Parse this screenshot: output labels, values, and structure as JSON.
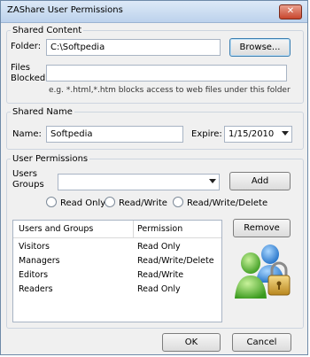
{
  "window": {
    "title": "ZAShare User Permissions",
    "close_glyph": "✕"
  },
  "shared_content": {
    "legend": "Shared Content",
    "folder_label": "Folder:",
    "folder_value": "C:\\Softpedia",
    "browse_label": "Browse...",
    "files_blocked_label_line1": "Files",
    "files_blocked_label_line2": "Blocked:",
    "files_blocked_value": "",
    "hint": "e.g. *.html,*.htm blocks access to web files under this folder"
  },
  "shared_name": {
    "legend": "Shared Name",
    "name_label": "Name:",
    "name_value": "Softpedia",
    "expire_label": "Expire:",
    "expire_value": "1/15/2010"
  },
  "user_permissions": {
    "legend": "User Permissions",
    "users_groups_label_line1": "Users",
    "users_groups_label_line2": "Groups",
    "users_groups_value": "",
    "add_label": "Add",
    "radio_read_only": "Read Only",
    "radio_read_write": "Read/Write",
    "radio_read_write_delete": "Read/Write/Delete",
    "remove_label": "Remove",
    "table": {
      "headers": [
        "Users and Groups",
        "Permission"
      ],
      "rows": [
        [
          "Visitors",
          "Read Only"
        ],
        [
          "Managers",
          "Read/Write/Delete"
        ],
        [
          "Editors",
          "Read/Write"
        ],
        [
          "Readers",
          "Read Only"
        ]
      ]
    }
  },
  "footer": {
    "ok_label": "OK",
    "cancel_label": "Cancel"
  }
}
